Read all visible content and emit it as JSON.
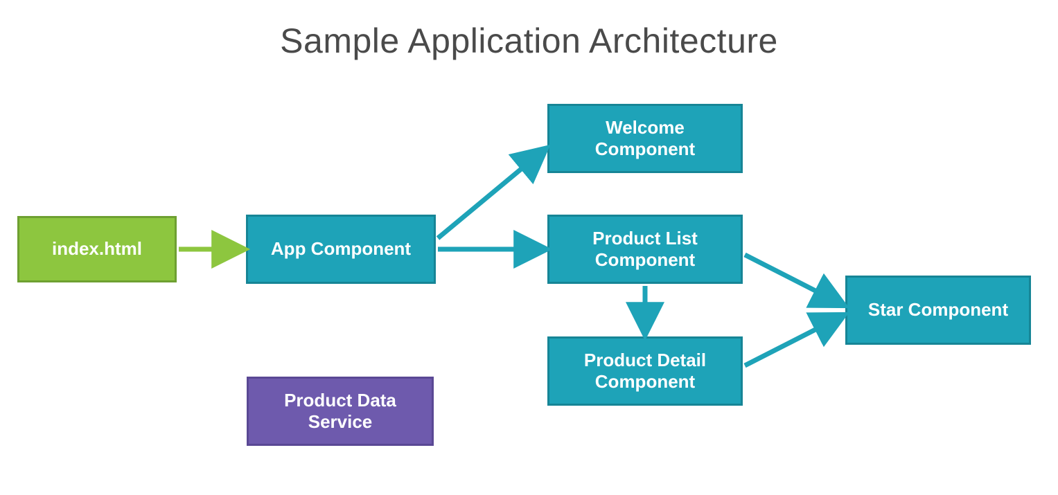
{
  "title": "Sample Application Architecture",
  "nodes": {
    "index": {
      "label": "index.html"
    },
    "app": {
      "label": "App Component"
    },
    "welcome": {
      "label": "Welcome Component"
    },
    "productList": {
      "label": "Product List Component"
    },
    "productDetail": {
      "label": "Product Detail Component"
    },
    "star": {
      "label": "Star Component"
    },
    "service": {
      "label": "Product Data Service"
    }
  },
  "colors": {
    "green": "#8dc63f",
    "teal": "#1ea3b8",
    "purple": "#6e5aad"
  }
}
